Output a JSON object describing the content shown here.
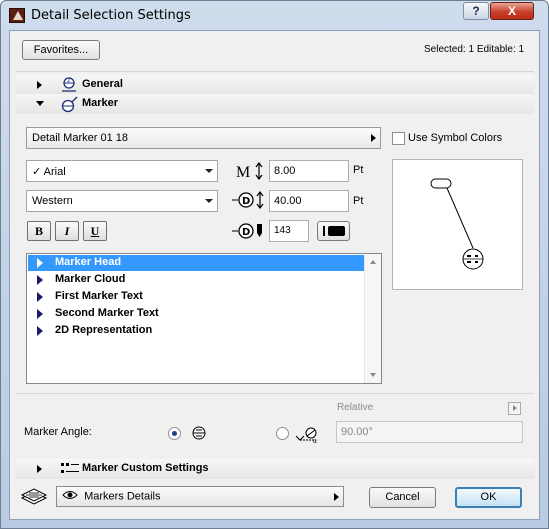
{
  "window": {
    "title": "Detail Selection Settings",
    "help_label": "?",
    "close_label": "X"
  },
  "toolbar": {
    "favorites_label": "Favorites...",
    "selection_info": "Selected: 1 Editable: 1"
  },
  "sections": {
    "general_label": "General",
    "marker_label": "Marker",
    "custom_label": "Marker Custom Settings"
  },
  "marker": {
    "type_value": "Detail Marker 01 18",
    "use_symbol_colors_label": "Use Symbol Colors",
    "font_value": "Arial",
    "font_checked_mark": "✓",
    "script_value": "Western",
    "size_value": "8.00",
    "size_unit": "Pt",
    "spacing_value": "40.00",
    "spacing_unit": "Pt",
    "pen_value": "143",
    "bold_label": "B",
    "italic_label": "I",
    "underline_label": "U"
  },
  "list_items": [
    {
      "label": "Marker Head",
      "selected": true
    },
    {
      "label": "Marker Cloud",
      "selected": false
    },
    {
      "label": "First Marker Text",
      "selected": false
    },
    {
      "label": "Second Marker Text",
      "selected": false
    },
    {
      "label": "2D Representation",
      "selected": false
    }
  ],
  "angle": {
    "label": "Marker Angle:",
    "relative_label": "Relative",
    "value": "90.00°",
    "horizontal_selected": true
  },
  "footer": {
    "layer_value": "Markers Details",
    "cancel_label": "Cancel",
    "ok_label": "OK"
  },
  "colors": {
    "selection": "#3399ff",
    "ok_border": "#3c7fb1"
  }
}
